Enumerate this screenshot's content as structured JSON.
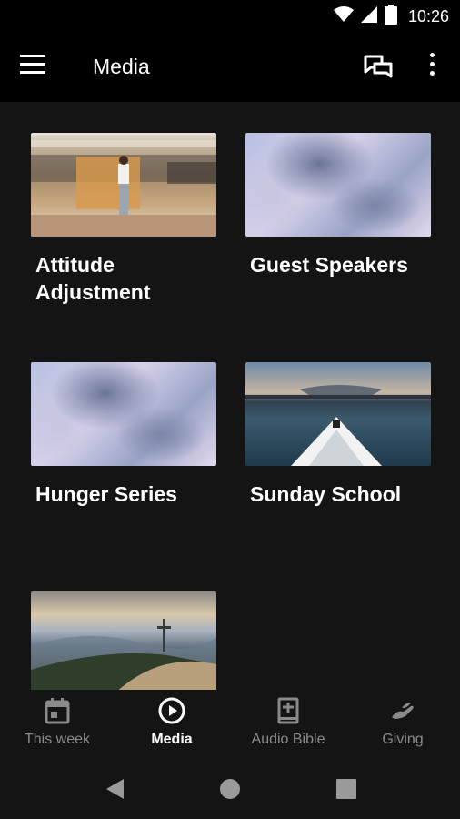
{
  "status_bar": {
    "time": "10:26"
  },
  "app_bar": {
    "title": "Media"
  },
  "cards": [
    {
      "title": "Attitude Adjustment",
      "image": "train-platform-photo"
    },
    {
      "title": "Guest Speakers",
      "image": "cloudy-sky-photo"
    },
    {
      "title": "Hunger Series",
      "image": "cloudy-sky-photo"
    },
    {
      "title": "Sunday School",
      "image": "kayak-lake-photo"
    },
    {
      "title": "",
      "image": "mountain-cross-photo"
    }
  ],
  "bottom_nav": {
    "items": [
      {
        "label": "This week",
        "icon": "calendar-icon",
        "active": false
      },
      {
        "label": "Media",
        "icon": "play-circle-icon",
        "active": true
      },
      {
        "label": "Audio Bible",
        "icon": "bible-icon",
        "active": false
      },
      {
        "label": "Giving",
        "icon": "giving-hand-icon",
        "active": false
      }
    ]
  },
  "system_nav": {
    "buttons": [
      "back-icon",
      "home-icon",
      "recents-icon"
    ]
  },
  "colors": {
    "background": "#141414",
    "bar": "#000000",
    "inactive": "#8a8a8a",
    "active": "#ffffff"
  }
}
